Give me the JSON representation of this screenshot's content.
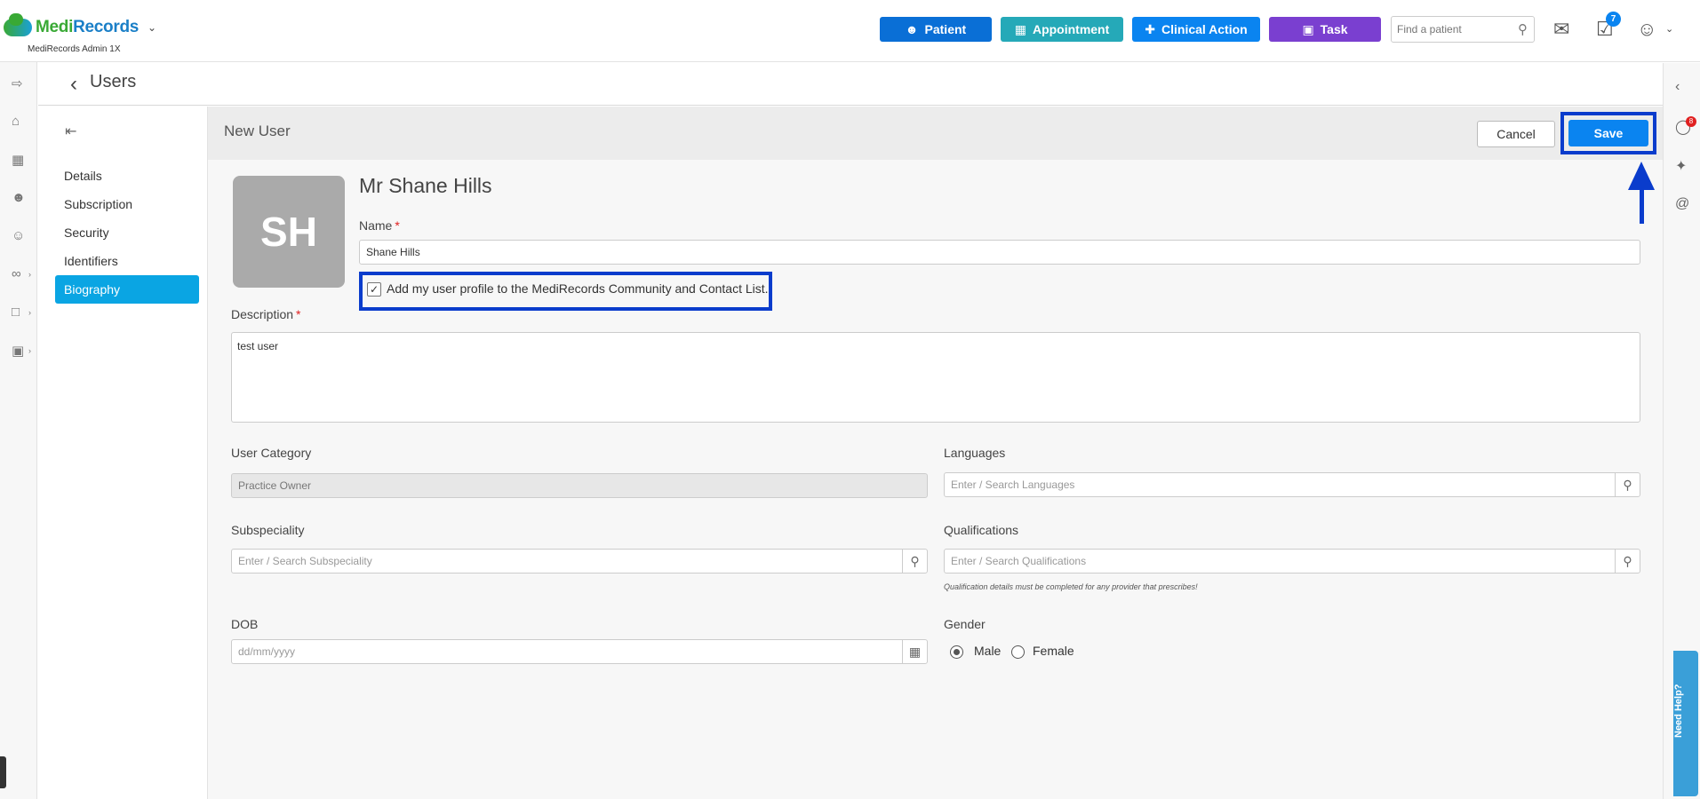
{
  "header": {
    "brand_medi": "Medi",
    "brand_records": "Records",
    "brand_sub": "MediRecords Admin 1X",
    "buttons": {
      "patient": "Patient",
      "appointment": "Appointment",
      "clinical_action": "Clinical Action",
      "task": "Task"
    },
    "search_placeholder": "Find a patient",
    "task_badge": "7"
  },
  "page": {
    "title": "Users"
  },
  "subnav": {
    "items": [
      "Details",
      "Subscription",
      "Security",
      "Identifiers",
      "Biography"
    ],
    "active": "Biography"
  },
  "form": {
    "title": "New User",
    "cancel_label": "Cancel",
    "save_label": "Save",
    "avatar_initials": "SH",
    "full_name": "Mr Shane Hills",
    "name_label": "Name",
    "name_value": "Shane Hills",
    "community_checkbox_label": "Add my user profile to the MediRecords Community and Contact List.",
    "community_checked": true,
    "description_label": "Description",
    "description_value": "test user",
    "user_category_label": "User Category",
    "user_category_value": "Practice Owner",
    "languages_label": "Languages",
    "languages_placeholder": "Enter / Search Languages",
    "subspeciality_label": "Subspeciality",
    "subspeciality_placeholder": "Enter / Search Subspeciality",
    "qualifications_label": "Qualifications",
    "qualifications_placeholder": "Enter / Search Qualifications",
    "qualifications_hint": "Qualification details must be completed for any provider that prescribes!",
    "dob_label": "DOB",
    "dob_placeholder": "dd/mm/yyyy",
    "gender_label": "Gender",
    "gender_options": [
      "Male",
      "Female"
    ],
    "gender_selected": "Male",
    "required_mark": "*"
  },
  "right_rail": {
    "notification_badge": "8",
    "help_label": "Need Help?"
  },
  "colors": {
    "primary_blue": "#0a84f0",
    "annotation_blue": "#0a3ccc",
    "active_nav": "#0aa5e3",
    "patient_btn": "#0a6fd6",
    "appointment_btn": "#25a9b8",
    "task_btn": "#7a3fd0"
  }
}
